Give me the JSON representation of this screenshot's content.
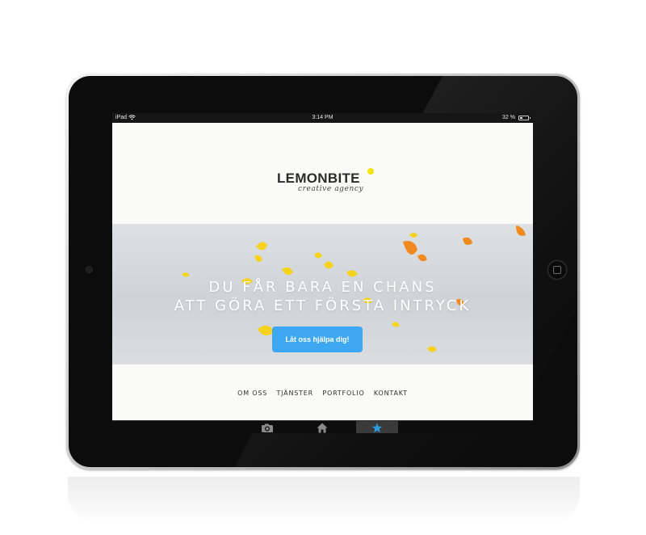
{
  "statusbar": {
    "device": "iPad",
    "time": "3:14 PM",
    "battery": "32 %"
  },
  "logo": {
    "name": "LEMONBITE",
    "tagline": "creative agency",
    "dot_color": "#f4e318"
  },
  "hero": {
    "line1": "DU FÅR BARA EN CHANS",
    "line2": "ATT GÖRA ETT FÖRSTA INTRYCK",
    "cta_label": "Låt oss hjälpa dig!",
    "cta_color": "#3ea7f2",
    "petal_colors": [
      "#f5d31c",
      "#f08a1e"
    ]
  },
  "nav": {
    "items": [
      "OM OSS",
      "TJÄNSTER",
      "PORTFOLIO",
      "KONTAKT"
    ]
  },
  "tabbar": {
    "tabs": [
      {
        "icon": "camera-icon"
      },
      {
        "icon": "home-icon"
      },
      {
        "icon": "star-icon",
        "active": true
      }
    ],
    "active_color": "#2a9be0"
  }
}
